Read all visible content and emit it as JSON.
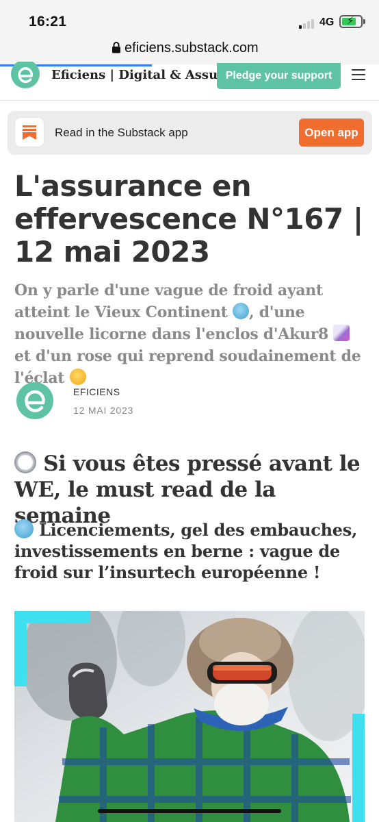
{
  "status_bar": {
    "time": "16:21",
    "network": "4G",
    "signal_bars_active": 1,
    "signal_bars_total": 4
  },
  "browser": {
    "url": "eficiens.substack.com",
    "lock_icon": "lock-icon"
  },
  "site_header": {
    "title": "Eficiens | Digital & Assur...",
    "pledge_label": "Pledge your support",
    "menu_icon": "hamburger-menu-icon"
  },
  "app_banner": {
    "text": "Read in the Substack app",
    "button_label": "Open app"
  },
  "post": {
    "title": "L'assurance en effervescence N°167 | 12 mai 2023",
    "subtitle_parts": [
      "On y parle d'une vague de froid ayant atteint le Vieux Continent ",
      ", d'une nouvelle licorne dans l'enclos d'Akur8 ",
      " et d'un rose qui reprend soudainement de l'éclat "
    ],
    "author": "EFICIENS",
    "date": "12 MAI 2023",
    "section_heading": "Si vous êtes pressé avant le WE, le must read de la semaine",
    "sub_heading": "Licenciements, gel des embauches, investissements en berne : vague de froid sur l’insurtech européenne !"
  },
  "colors": {
    "brand_green": "#5ec3a3",
    "substack_orange": "#f06d2e",
    "link_blue": "#2d7ff9"
  },
  "icons": [
    "lock-icon",
    "eficiens-logo",
    "hamburger-menu-icon",
    "substack-icon",
    "cold-face-emoji",
    "unicorn-emoji",
    "star-struck-emoji",
    "stopwatch-emoji"
  ]
}
